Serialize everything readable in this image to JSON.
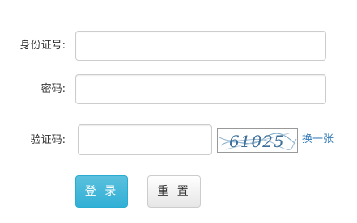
{
  "form": {
    "id_label": "身份证号:",
    "id_value": "",
    "password_label": "密码:",
    "password_value": "",
    "captcha_label": "验证码:",
    "captcha_value": "",
    "captcha_image_text": "61025",
    "refresh_label": "换一张"
  },
  "buttons": {
    "login_label": "登 录",
    "reset_label": "重 置"
  },
  "colors": {
    "login_button": "#46b8da",
    "link": "#337ab7",
    "captcha_text": "#3d6f9a"
  }
}
